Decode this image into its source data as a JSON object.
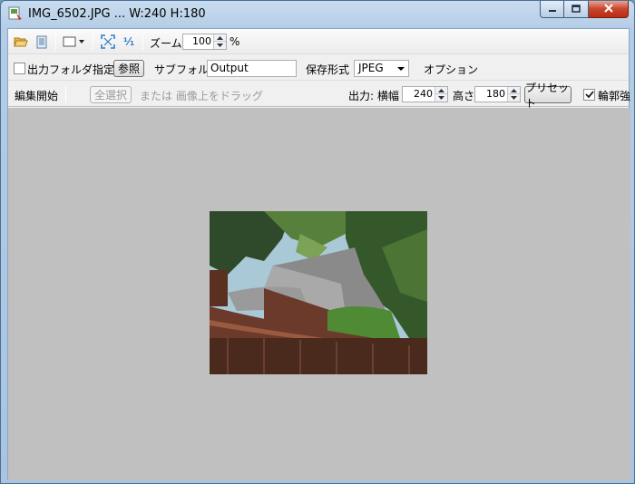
{
  "window": {
    "title": "IMG_6502.JPG ... W:240 H:180",
    "icons": [
      "app-icon",
      "minimize-icon",
      "maximize-icon",
      "close-icon"
    ]
  },
  "toolbar": {
    "icons": [
      "open-folder-icon",
      "document-icon",
      "view-mode-icon",
      "fit-screen-icon",
      "actual-size-icon"
    ],
    "actual_size_glyph": "¹⁄₁",
    "zoom_label": "ズーム",
    "zoom_value": "100",
    "zoom_unit": "%"
  },
  "output": {
    "output_folder_label": "出力フォルダ指定",
    "output_folder_checked": false,
    "browse_label": "参照",
    "subfolder_label": "サブフォルダ",
    "subfolder_value": "Output",
    "format_label": "保存形式",
    "format_value": "JPEG",
    "options_label": "オプション"
  },
  "edit": {
    "start_label": "編集開始",
    "select_all_label": "全選択",
    "drag_hint": "または 画像上をドラッグ",
    "output_width_label": "出力: 横幅",
    "width_value": "240",
    "height_label": "高さ",
    "height_value": "180",
    "preset_label": "プリセット",
    "outline_label": "輪郭強",
    "outline_checked": true
  },
  "preview": {
    "image_description_alt": "IMG_6502.JPG",
    "colors": {
      "canvas": "#c0c0c0",
      "sky": "#a9c9d6",
      "roof": "#8a8a8a",
      "wood": "#6b3a2a"
    }
  }
}
